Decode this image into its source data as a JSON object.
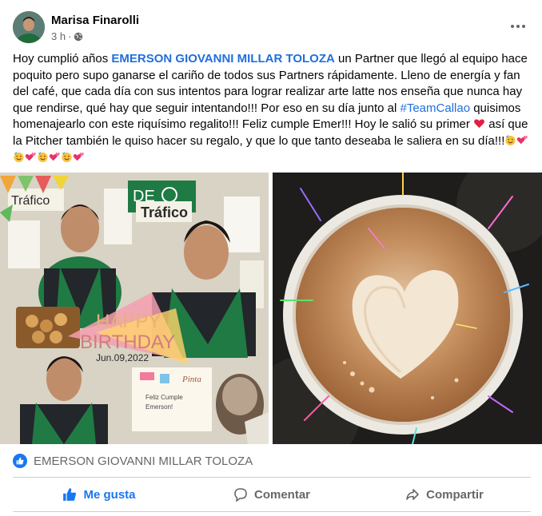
{
  "post": {
    "author": "Marisa Finarolli",
    "time": "3 h",
    "separator": "·",
    "text": {
      "p1": "Hoy cumplió años ",
      "tagged_name": "EMERSON GIOVANNI MILLAR TOLOZA",
      "p2": " un Partner que llegó al equipo hace poquito pero supo ganarse el cariño de todos sus Partners rápidamente. Lleno de energía y fan del café, que cada día con sus intentos para lograr realizar arte latte nos enseña que nunca hay que rendirse, qué hay que seguir intentando!!! Por eso en su día junto al ",
      "hashtag": "#TeamCallao",
      "p3": " quisimos homenajearlo con este riquísimo regalito!!! Feliz cumple Emer!!! Hoy le salió su primer ",
      "p4": " así que la Pitcher también le quiso hacer su regalo, y que lo que tanto deseaba le saliera en su día!!!"
    },
    "collage": {
      "store_sign_1": "DE",
      "store_sign_2": "Tráfico",
      "store_sign_3": "Tráfico",
      "happy": "HAPPY",
      "birthday": "BIRTHDAY",
      "date": "Jun.09,2022",
      "card_line1": "Feliz Cumple",
      "card_line2": "Emerson!",
      "card_brand": "Pinta"
    }
  },
  "reactions": {
    "liked_by": "EMERSON GIOVANNI MILLAR TOLOZA"
  },
  "actions": {
    "like": "Me gusta",
    "comment": "Comentar",
    "share": "Compartir"
  },
  "colors": {
    "accent": "#1877f2",
    "link": "#216fdb",
    "muted": "#65676b",
    "heart": "#e41e3f",
    "starbucks_green": "#1f7a44"
  },
  "icons": [
    "globe-icon",
    "more-icon",
    "like-icon",
    "comment-icon",
    "share-icon",
    "heart-emoji",
    "party-face-emoji",
    "two-hearts-emoji"
  ]
}
